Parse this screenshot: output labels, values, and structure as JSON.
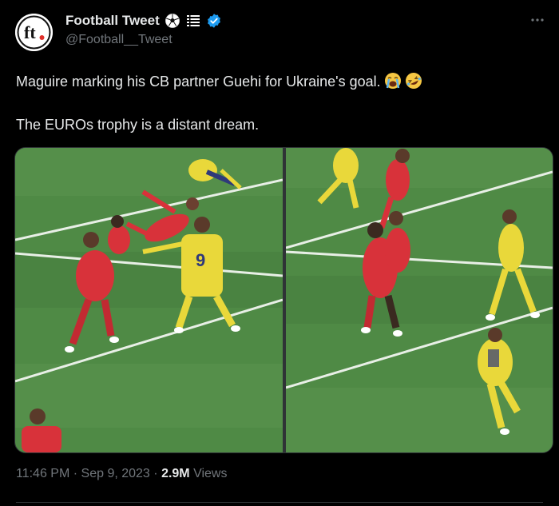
{
  "author": {
    "display_name": "Football Tweet",
    "handle": "@Football__Tweet",
    "avatar_text": "ft",
    "badges": [
      "soccer-ball-emoji",
      "list-emoji",
      "verified-badge"
    ]
  },
  "tweet": {
    "line1": "Maguire marking his CB partner Guehi for Ukraine's goal.",
    "line1_emojis": [
      "loudly-crying-face",
      "rolling-on-floor-laughing"
    ],
    "line2": "The EUROs trophy is a distant dream."
  },
  "media": {
    "frames": 2,
    "jersey_number": "9"
  },
  "footer": {
    "time": "11:46 PM",
    "separator": "·",
    "date": "Sep 9, 2023",
    "views_count": "2.9M",
    "views_label": "Views"
  },
  "colors": {
    "background": "#000000",
    "text": "#e7e9ea",
    "muted": "#71767b",
    "verified": "#1d9bf0",
    "pitch": "#4f8a45",
    "england_red": "#d8323a",
    "ukraine_yellow": "#e9d83a"
  }
}
